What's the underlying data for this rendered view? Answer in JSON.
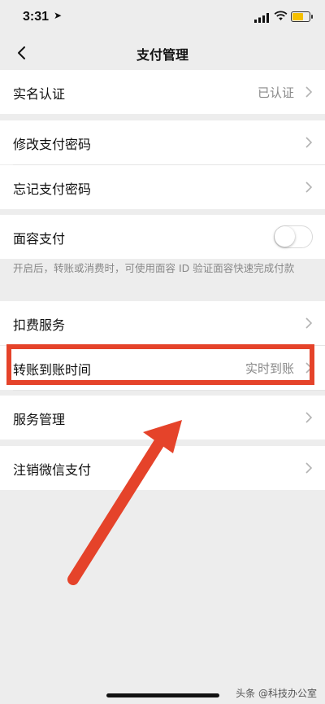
{
  "status": {
    "time": "3:31",
    "location_glyph": "➤",
    "battery_color": "#f5c000"
  },
  "nav": {
    "title": "支付管理"
  },
  "rows": {
    "realname": {
      "label": "实名认证",
      "value": "已认证"
    },
    "change_password": {
      "label": "修改支付密码"
    },
    "forgot_password": {
      "label": "忘记支付密码"
    },
    "face_pay": {
      "label": "面容支付",
      "toggle_on": false
    },
    "deduction": {
      "label": "扣费服务"
    },
    "transfer_time": {
      "label": "转账到账时间",
      "value": "实时到账"
    },
    "service_mgmt": {
      "label": "服务管理"
    },
    "cancel_pay": {
      "label": "注销微信支付"
    }
  },
  "note": "开启后，转账或消费时，可使用面容 ID 验证面容快速完成付款",
  "annotation": {
    "highlight_color": "#e5432a"
  },
  "watermark": "头条 @科技办公室"
}
